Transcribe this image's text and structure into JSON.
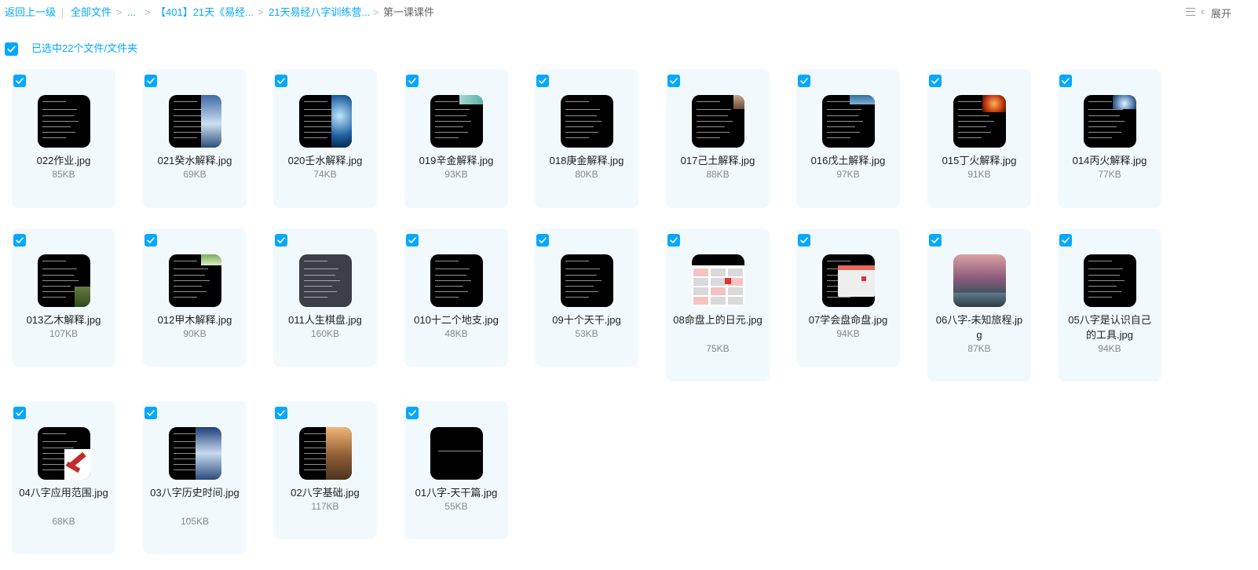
{
  "breadcrumb": {
    "back": "返回上一级",
    "all": "全部文件",
    "ellipsis": "...",
    "folder1": "【401】21天《易经...",
    "folder2": "21天易经八字训练营...",
    "current": "第一课课件",
    "separator": ">"
  },
  "toolbar": {
    "expand_label": "展开"
  },
  "selection": {
    "text": "已选中22个文件/文件夹"
  },
  "files": [
    {
      "name": "022作业.jpg",
      "size": "85KB"
    },
    {
      "name": "021癸水解释.jpg",
      "size": "69KB"
    },
    {
      "name": "020壬水解释.jpg",
      "size": "74KB"
    },
    {
      "name": "019辛金解释.jpg",
      "size": "93KB"
    },
    {
      "name": "018庚金解释.jpg",
      "size": "80KB"
    },
    {
      "name": "017己土解释.jpg",
      "size": "88KB"
    },
    {
      "name": "016戊土解释.jpg",
      "size": "97KB"
    },
    {
      "name": "015丁火解释.jpg",
      "size": "91KB"
    },
    {
      "name": "014丙火解释.jpg",
      "size": "77KB"
    },
    {
      "name": "013乙木解释.jpg",
      "size": "107KB"
    },
    {
      "name": "012甲木解释.jpg",
      "size": "90KB"
    },
    {
      "name": "011人生棋盘.jpg",
      "size": "160KB"
    },
    {
      "name": "010十二个地支.jpg",
      "size": "48KB"
    },
    {
      "name": "09十个天干.jpg",
      "size": "53KB"
    },
    {
      "name": "08命盘上的日元.jpg",
      "size": "75KB"
    },
    {
      "name": "07学会盘命盘.jpg",
      "size": "94KB"
    },
    {
      "name": "06八字-未知旅程.jpg",
      "size": "87KB"
    },
    {
      "name": "05八字是认识自己的工具.jpg",
      "size": "94KB"
    },
    {
      "name": "04八字应用范围.jpg",
      "size": "68KB"
    },
    {
      "name": "03八字历史时间.jpg",
      "size": "105KB"
    },
    {
      "name": "02八字基础.jpg",
      "size": "117KB"
    },
    {
      "name": "01八字-天干篇.jpg",
      "size": "55KB"
    }
  ],
  "colors": {
    "accent": "#06a7ff",
    "tile_bg": "#f1f9fd"
  }
}
